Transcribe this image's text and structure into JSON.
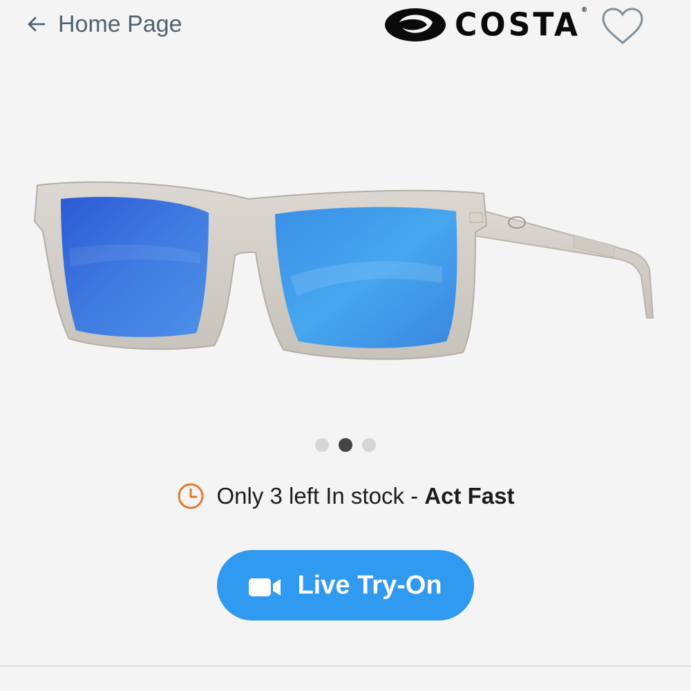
{
  "header": {
    "back_label": "Home Page",
    "brand_name": "COSTA",
    "brand_mark": "®"
  },
  "product": {
    "image_icon": "sunglasses-image"
  },
  "carousel": {
    "slide_count": 3,
    "active_slide": 2
  },
  "stock": {
    "message": "Only 3 left In stock - ",
    "emphasis": "Act Fast"
  },
  "actions": {
    "try_on_label": "Live Try-On"
  },
  "colors": {
    "accent": "#2f9af0",
    "clock": "#e07a2e",
    "back_text": "#4f6272",
    "heart": "#7e8f9b"
  }
}
